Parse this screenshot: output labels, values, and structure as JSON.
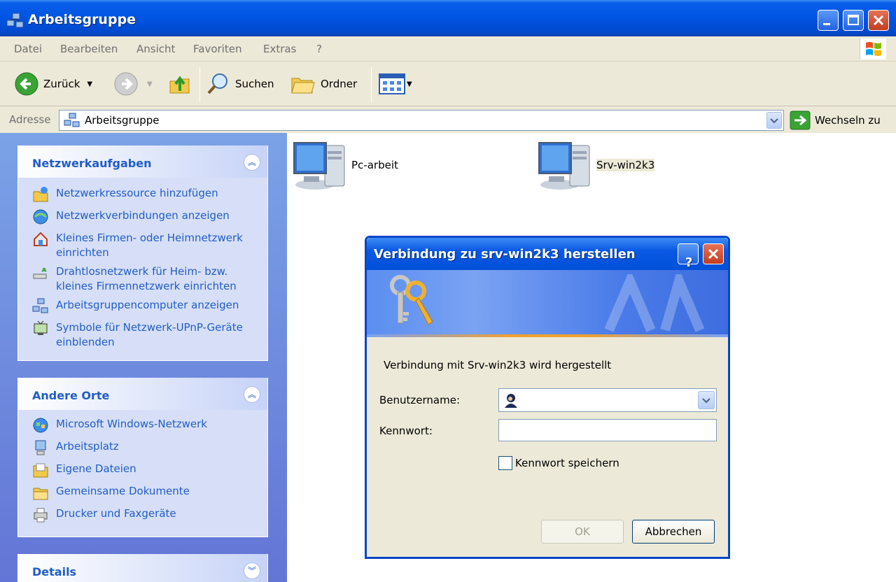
{
  "window": {
    "title": "Arbeitsgruppe",
    "controls": [
      "minimize-icon",
      "maximize-icon",
      "close-icon"
    ]
  },
  "menu": {
    "items": [
      "Datei",
      "Bearbeiten",
      "Ansicht",
      "Favoriten",
      "Extras",
      "?"
    ]
  },
  "toolbar": {
    "back_label": "Zurück",
    "search_label": "Suchen",
    "folders_label": "Ordner"
  },
  "address": {
    "label": "Adresse",
    "value": "Arbeitsgruppe",
    "go_label": "Wechseln zu"
  },
  "sidebar": {
    "network_tasks": {
      "title": "Netzwerkaufgaben",
      "items": [
        {
          "label": "Netzwerkressource hinzufügen",
          "icon": "add-network-place-icon"
        },
        {
          "label": "Netzwerkverbindungen anzeigen",
          "icon": "network-connections-icon"
        },
        {
          "label": "Kleines Firmen- oder Heimnetzwerk einrichten",
          "icon": "home-network-icon"
        },
        {
          "label": "Drahtlosnetzwerk für Heim- bzw. kleines Firmennetzwerk einrichten",
          "icon": "wireless-network-icon"
        },
        {
          "label": "Arbeitsgruppencomputer anzeigen",
          "icon": "workgroup-computers-icon"
        },
        {
          "label": "Symbole für Netzwerk-UPnP-Geräte einblenden",
          "icon": "upnp-device-icon"
        }
      ]
    },
    "other_places": {
      "title": "Andere Orte",
      "items": [
        {
          "label": "Microsoft Windows-Netzwerk",
          "icon": "windows-network-icon"
        },
        {
          "label": "Arbeitsplatz",
          "icon": "my-computer-icon"
        },
        {
          "label": "Eigene Dateien",
          "icon": "my-documents-icon"
        },
        {
          "label": "Gemeinsame Dokumente",
          "icon": "shared-documents-folder-icon"
        },
        {
          "label": "Drucker und Faxgeräte",
          "icon": "printers-faxes-icon"
        }
      ]
    },
    "details": {
      "title": "Details"
    }
  },
  "content": {
    "computers": [
      {
        "name": "Pc-arbeit"
      },
      {
        "name": "Srv-win2k3"
      }
    ]
  },
  "dialog": {
    "title": "Verbindung zu srv-win2k3 herstellen",
    "message": "Verbindung mit Srv-win2k3 wird hergestellt",
    "username_label": "Benutzername:",
    "username_value": "",
    "password_label": "Kennwort:",
    "password_value": "",
    "remember_label": "Kennwort speichern",
    "remember_checked": false,
    "ok_label": "OK",
    "cancel_label": "Abbrechen"
  },
  "colors": {
    "xp_blue": "#0055e5",
    "sidebar_link": "#215dc6",
    "sidebar_bg": "#6375d6",
    "panel_bg": "#d6dff7",
    "dialog_bg": "#ece9d8"
  }
}
